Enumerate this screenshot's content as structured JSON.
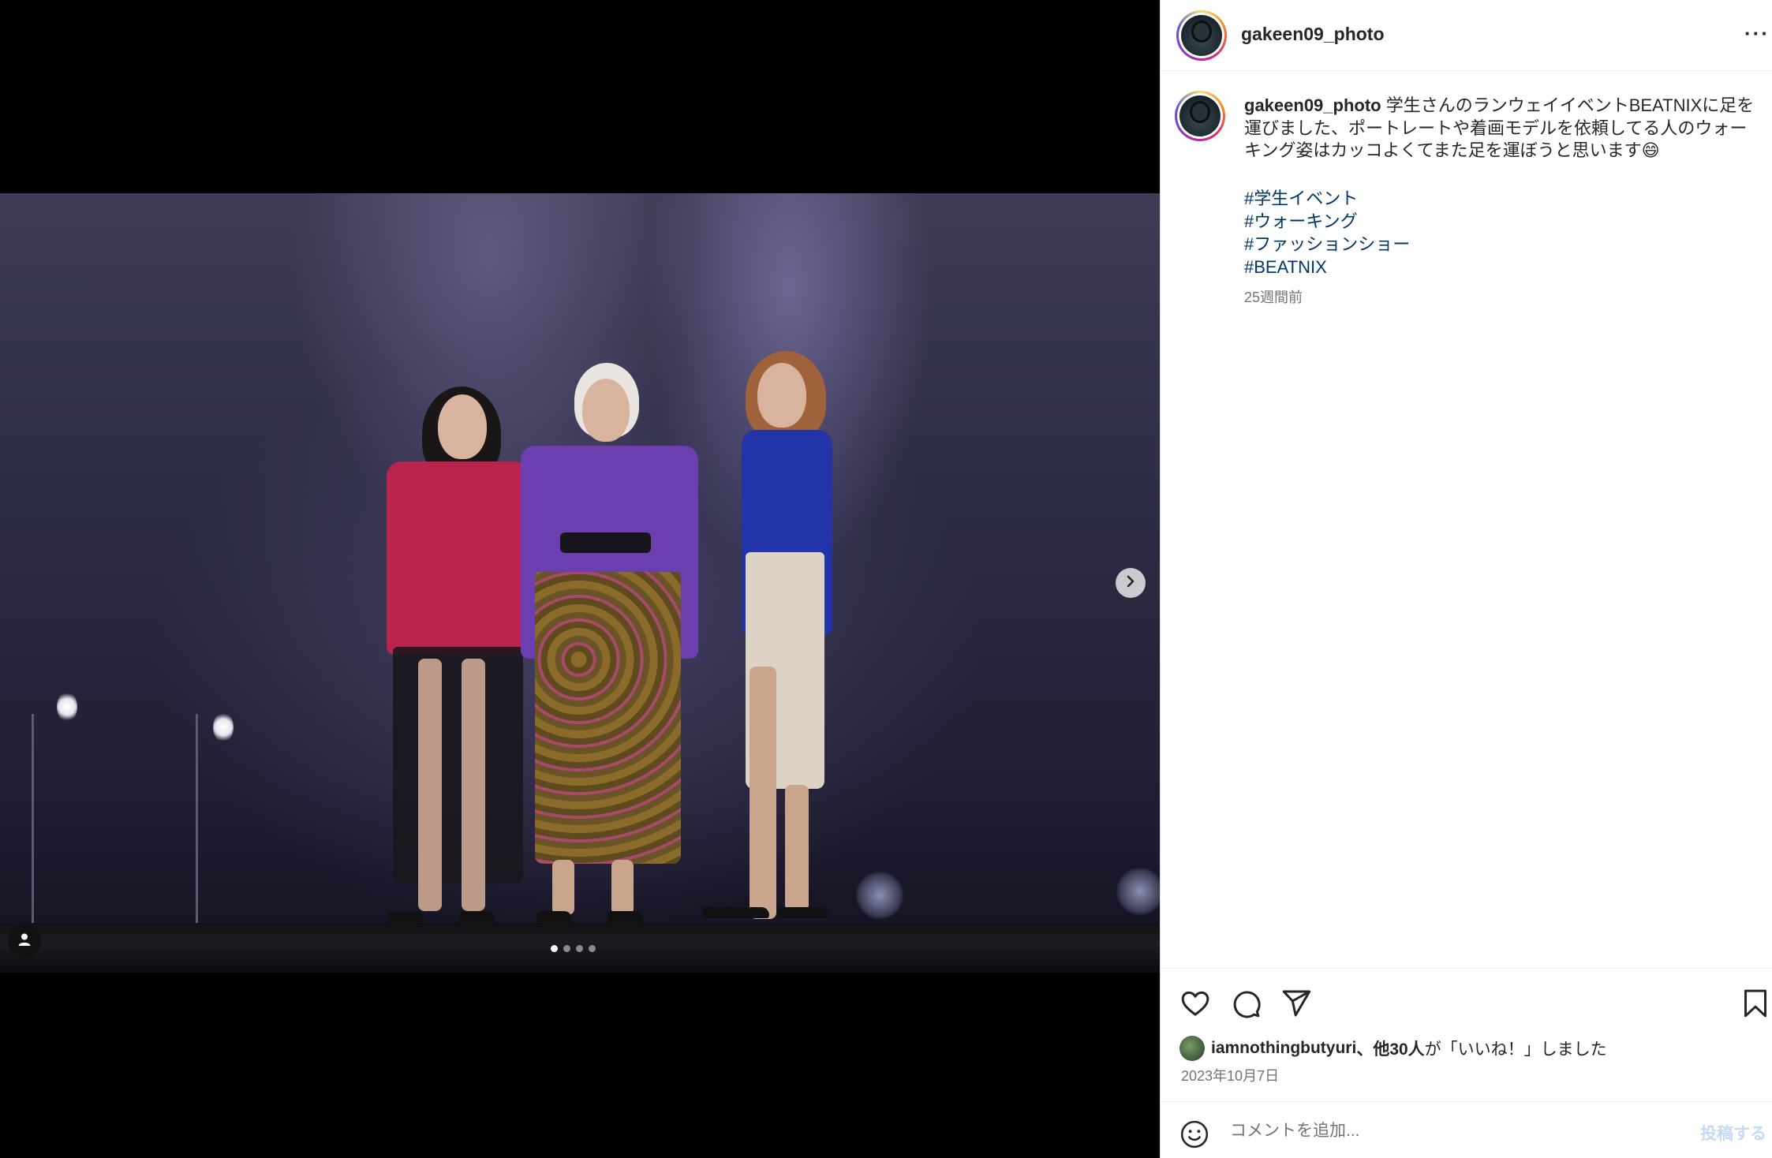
{
  "header": {
    "username": "gakeen09_photo",
    "more_label": "···"
  },
  "media": {
    "image_alt": "Three models on a runway stage",
    "carousel_count": 4,
    "carousel_active": 1
  },
  "caption": {
    "username": "gakeen09_photo",
    "text": "学生さんのランウェイイベントBEATNIXに足を運びました、ポートレートや着画モデルを依頼してる人のウォーキング姿はカッコよくてまた足を運ぼうと思います😄",
    "hashtags": [
      "#学生イベント",
      "#ウォーキング",
      "#ファッションショー",
      "#BEATNIX"
    ],
    "time": "25週間前"
  },
  "likes": {
    "liker": "iamnothingbutyuri",
    "others": "、他30人",
    "suffix": "が「いいね！」しました"
  },
  "date": "2023年10月7日",
  "comment": {
    "placeholder": "コメントを追加...",
    "post_label": "投稿する"
  },
  "icons": {
    "like": "heart-icon",
    "comment": "comment-icon",
    "share": "share-icon",
    "save": "bookmark-icon",
    "emoji": "emoji-icon",
    "next": "chevron-right-icon",
    "tag": "user-tag-icon"
  },
  "colors": {
    "hashtag": "#00376b",
    "post_button_disabled": "#c5d9f5",
    "secondary_text": "#737373"
  }
}
